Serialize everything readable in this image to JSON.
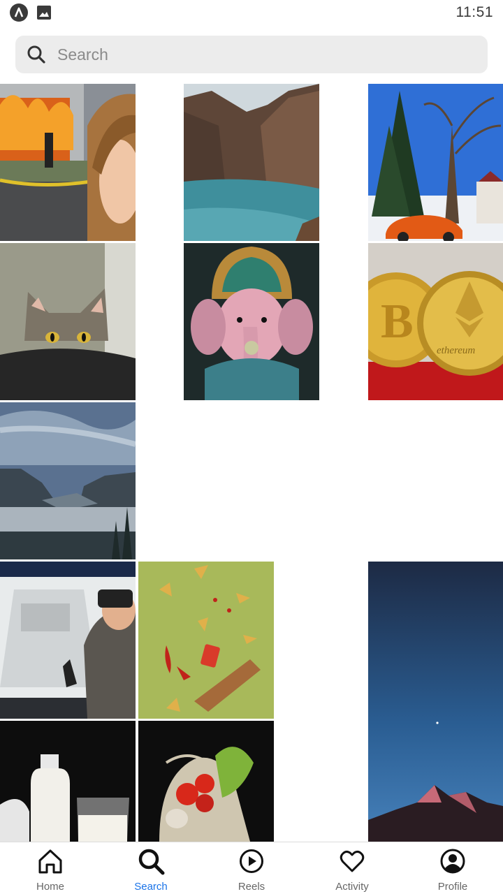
{
  "status_bar": {
    "time": "11:51"
  },
  "search": {
    "placeholder": "Search",
    "value": ""
  },
  "grid": {
    "tiles": [
      {
        "name": "photo-house-fire-girl",
        "subject": "girl smiling in front of burning house"
      },
      {
        "name": "photo-mountain-lake",
        "subject": "turquoise lake between rocky cliffs"
      },
      {
        "name": "photo-orange-beetle",
        "subject": "orange car in snow under trees"
      },
      {
        "name": "photo-cat-peeking",
        "subject": "tabby cat peeking over table"
      },
      {
        "name": "photo-ganesha-idol",
        "subject": "ornate Ganesha statue"
      },
      {
        "name": "photo-crypto-coins",
        "subject": "bitcoin and ethereum coins",
        "caption": "ethereum"
      },
      {
        "name": "photo-misty-valley",
        "subject": "misty mountain valley"
      },
      {
        "name": "photo-vr-headset",
        "subject": "man using VR headset"
      },
      {
        "name": "photo-flying-food",
        "subject": "floating chips and peppers"
      },
      {
        "name": "photo-night-mountain",
        "subject": "mountain peak under night sky"
      },
      {
        "name": "photo-milk-bottle",
        "subject": "milk bottle and glass"
      },
      {
        "name": "photo-vegetable-bag",
        "subject": "vegetables in mesh bag"
      }
    ]
  },
  "nav": {
    "items": [
      {
        "label": "Home",
        "icon": "home-icon",
        "active": false
      },
      {
        "label": "Search",
        "icon": "search-icon",
        "active": true
      },
      {
        "label": "Reels",
        "icon": "reels-icon",
        "active": false
      },
      {
        "label": "Activity",
        "icon": "heart-icon",
        "active": false
      },
      {
        "label": "Profile",
        "icon": "profile-icon",
        "active": false
      }
    ]
  },
  "colors": {
    "accent": "#1a73e8",
    "search_bg": "#ececec"
  }
}
